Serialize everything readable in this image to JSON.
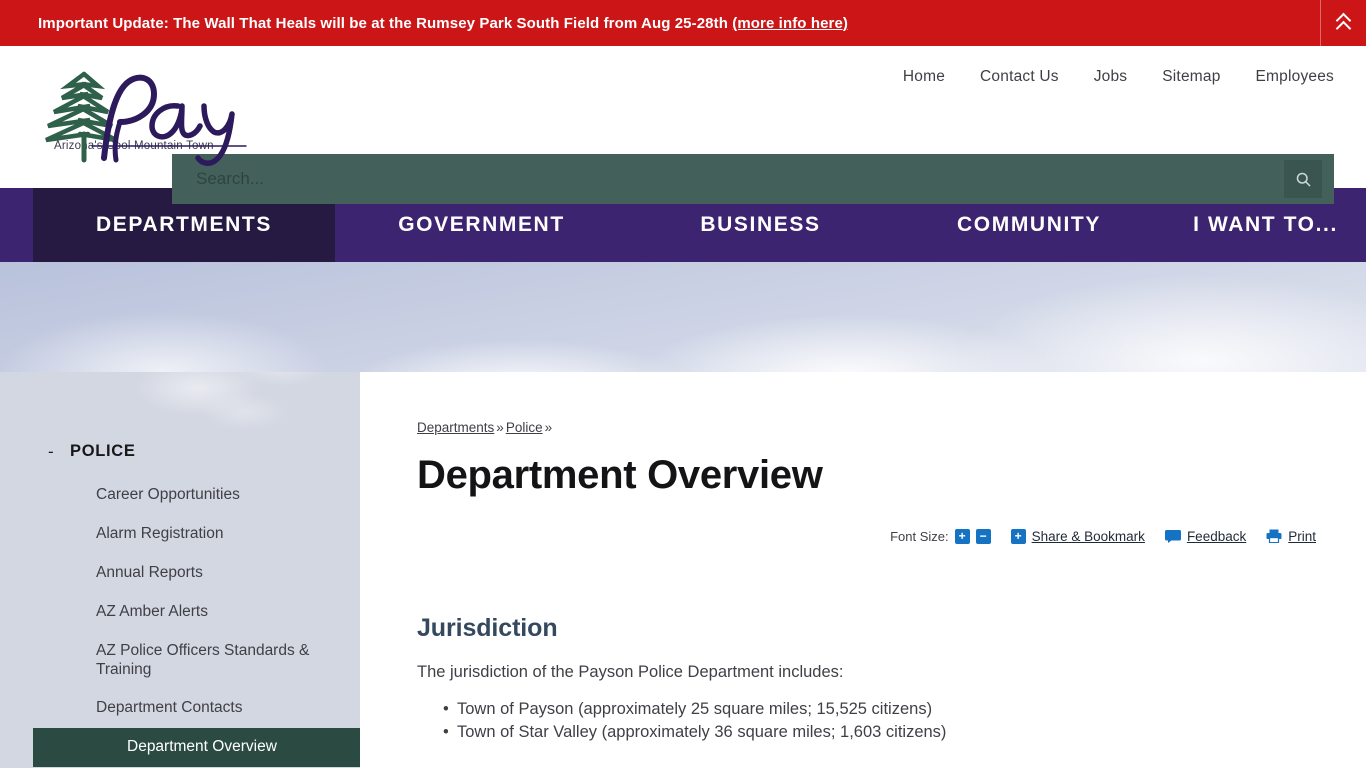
{
  "alert": {
    "text_before": "Important Update: The Wall That Heals will be at the Rumsey Park South Field from Aug 25-28th ",
    "link_text": "(more info here)",
    "toggle_icon": "double-chevron-up-icon",
    "bg_color": "#cb1517"
  },
  "logo": {
    "name": "Payson",
    "tagline": "Arizona's           Cool Mountain Town",
    "tree_color": "#2f6049",
    "wordmark_color": "#2c1a5c"
  },
  "top_nav": {
    "items": [
      {
        "label": "Home"
      },
      {
        "label": "Contact Us"
      },
      {
        "label": "Jobs"
      },
      {
        "label": "Sitemap"
      },
      {
        "label": "Employees"
      }
    ]
  },
  "search": {
    "placeholder": "Search...",
    "value": "",
    "button_icon": "search-icon",
    "bg_color": "#44605a"
  },
  "main_nav": {
    "bg_color": "#3d2470",
    "active_bg_color": "#271a42",
    "items": [
      {
        "label": "DEPARTMENTS",
        "active": true
      },
      {
        "label": "GOVERNMENT",
        "active": false
      },
      {
        "label": "BUSINESS",
        "active": false
      },
      {
        "label": "COMMUNITY",
        "active": false
      },
      {
        "label": "I WANT TO...",
        "active": false
      }
    ]
  },
  "sidebar": {
    "bg_color": "#d3d7e2",
    "active_bg_color": "#2b4a41",
    "section": {
      "toggle": "-",
      "label": "POLICE"
    },
    "items": [
      {
        "label": "Career Opportunities",
        "active": false
      },
      {
        "label": "Alarm Registration",
        "active": false
      },
      {
        "label": "Annual Reports",
        "active": false
      },
      {
        "label": "AZ Amber Alerts",
        "active": false
      },
      {
        "label": "AZ Police Officers Standards & Training",
        "active": false
      },
      {
        "label": "Department Contacts",
        "active": false
      },
      {
        "label": "Department Overview",
        "active": true
      }
    ]
  },
  "breadcrumb": {
    "items": [
      {
        "label": "Departments"
      },
      {
        "label": "Police"
      }
    ],
    "separator": "»",
    "trailing_separator": "»"
  },
  "page": {
    "title": "Department Overview"
  },
  "toolbar": {
    "font_size_label": "Font Size:",
    "font_increase": "+",
    "font_decrease": "−",
    "share_plus": "+",
    "share_label": "Share & Bookmark",
    "feedback_label": "Feedback",
    "print_label": "Print",
    "accent_color": "#1673c4"
  },
  "main": {
    "heading": "Jurisdiction",
    "intro": "The jurisdiction of the Payson Police Department includes:",
    "bullets": [
      "Town of Payson (approximately 25 square miles; 15,525 citizens)",
      "Town of Star Valley (approximately 36 square miles; 1,603 citizens)"
    ]
  }
}
